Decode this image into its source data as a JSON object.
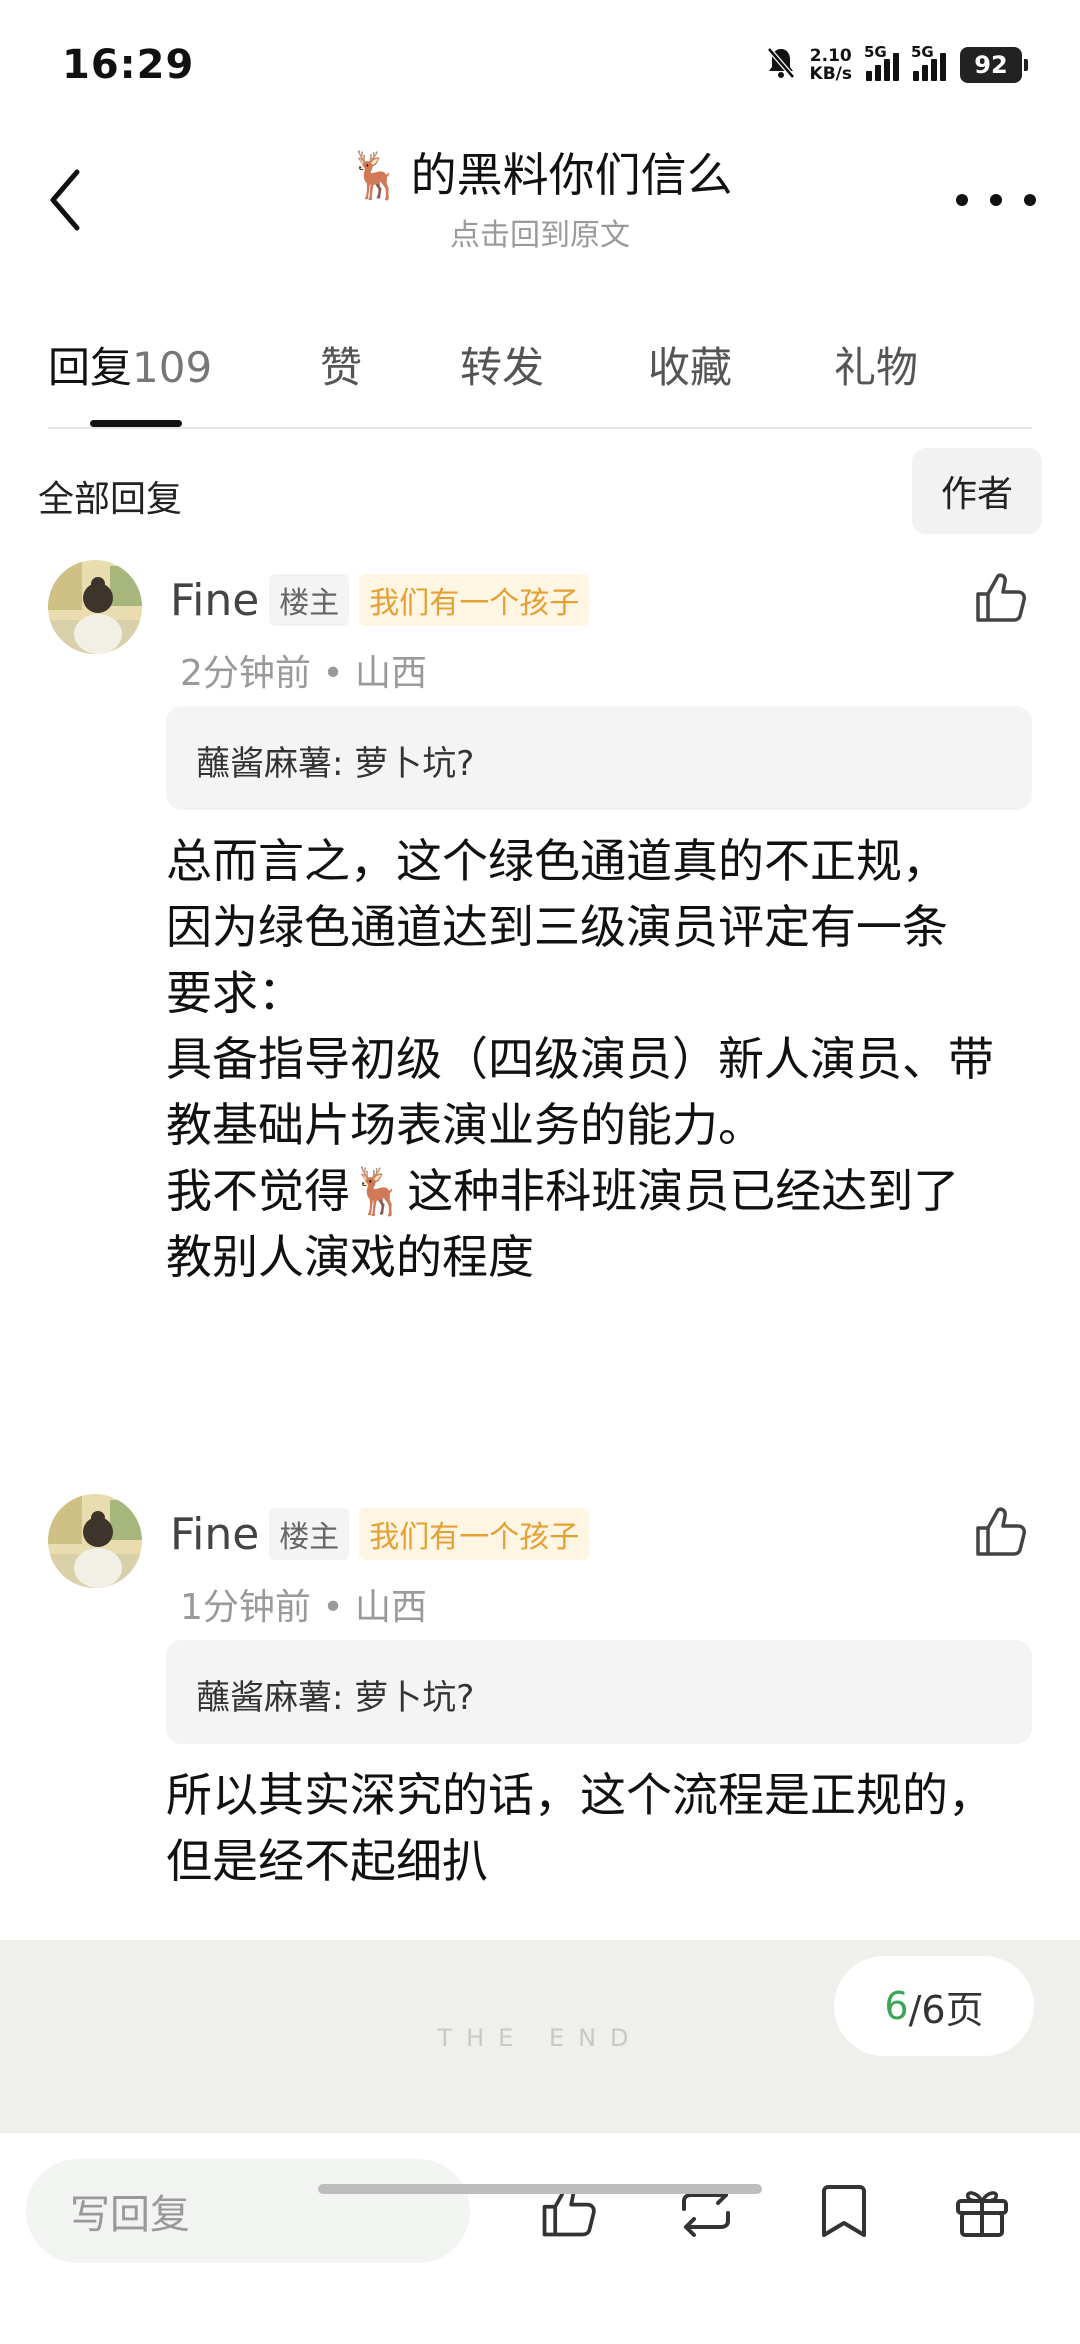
{
  "status_bar": {
    "time": "16:29",
    "net_speed_value": "2.10",
    "net_speed_unit": "KB/s",
    "signal1_label": "5G",
    "signal2_label": "5G",
    "battery": "92"
  },
  "header": {
    "deer_emoji": "🦌",
    "title": "的黑料你们信么",
    "subtitle": "点击回到原文"
  },
  "tabs": [
    {
      "label": "回复",
      "count": "109",
      "active": true
    },
    {
      "label": "赞"
    },
    {
      "label": "转发"
    },
    {
      "label": "收藏"
    },
    {
      "label": "礼物"
    }
  ],
  "filter": {
    "label": "全部回复",
    "author_button": "作者"
  },
  "comments": [
    {
      "name": "Fine",
      "op_badge": "楼主",
      "title_badge": "我们有一个孩子",
      "meta": "2分钟前 • 山西",
      "quote": "蘸酱麻薯: 萝卜坑?",
      "body": "总而言之，这个绿色通道真的不正规，\n因为绿色通道达到三级演员评定有一条\n要求：\n具备指导初级（四级演员）新人演员、带\n教基础片场表演业务的能力。\n我不觉得🦌这种非科班演员已经达到了\n教别人演戏的程度"
    },
    {
      "name": "Fine",
      "op_badge": "楼主",
      "title_badge": "我们有一个孩子",
      "meta": "1分钟前 • 山西",
      "quote": "蘸酱麻薯: 萝卜坑?",
      "body": "所以其实深究的话，这个流程是正规的，\n但是经不起细扒"
    }
  ],
  "end_section": {
    "end_text": "THE END",
    "page_current": "6",
    "page_rest": "/6页"
  },
  "bottom_bar": {
    "reply_placeholder": "写回复"
  },
  "colors": {
    "badge_title": "#e4a032",
    "page_current": "#3aa757"
  }
}
